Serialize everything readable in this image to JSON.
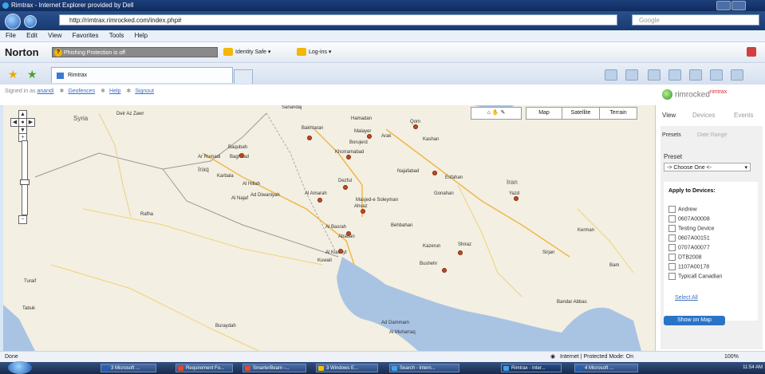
{
  "window": {
    "title": "Rimtrax - Internet Explorer provided by Dell"
  },
  "address": {
    "url": "http://rimtrax.rimrocked.com/index.php#",
    "search_placeholder": "Google"
  },
  "menu": {
    "items": [
      "File",
      "Edit",
      "View",
      "Favorites",
      "Tools",
      "Help"
    ]
  },
  "norton": {
    "logo": "Norton",
    "phishing": "Phishing Protection is off",
    "identity": "Identity Safe ▾",
    "login": "Log-ins ▾"
  },
  "tab": {
    "label": "Rimtrax"
  },
  "app": {
    "signed_prefix": "Signed in as",
    "user": "anandi",
    "links": [
      "Geofences",
      "Help",
      "Signout"
    ],
    "logo_text": "rimrocked",
    "logo_sup": "rimtrax"
  },
  "map": {
    "types": [
      "Map",
      "Satellite",
      "Terrain"
    ],
    "countries": [
      "Syria",
      "Iraq",
      "Iran"
    ],
    "cities": [
      "Deir Az Zawr",
      "Sanandaj",
      "Hamadan",
      "Qom",
      "Bakhtaran",
      "Malayer",
      "Arak",
      "Kashan",
      "Borujerd",
      "Khorramabad",
      "Baqubah",
      "Baghdad",
      "Ar Rumadi",
      "Karbala",
      "Dezful",
      "Najafabad",
      "Esfahan",
      "Al Hillah",
      "Ad Diwaniyah",
      "Al Najaf",
      "Al Amarah",
      "Masjed-e Soleyman",
      "Gonahan",
      "Yazd",
      "Ahvaz",
      "Rafha",
      "Al Basrah",
      "Behbahan",
      "Abadan",
      "Kerman",
      "Kazerun",
      "Shiraz",
      "Al Kuwayt",
      "Kuwait",
      "Bushehr",
      "Sirjan",
      "Bam",
      "Turaif",
      "Tabuk",
      "Bandar Abbas",
      "Ad Dammam",
      "Al Muharraq",
      "Buraydah"
    ]
  },
  "sidebar": {
    "tabs": [
      "View",
      "Devices",
      "Events"
    ],
    "subtabs": [
      "Presets",
      "Date Range"
    ],
    "preset_label": "Preset",
    "preset_value": "-> Choose One <-",
    "apply_label": "Apply to Devices:",
    "devices": [
      "Andrew",
      "0607A00008",
      "Testing Device",
      "0607A00151",
      "0707A00077",
      "DTB2008",
      "1107A00178",
      "Typicall Canadian"
    ],
    "select_all": "Select All",
    "show_on_map": "Show on Map"
  },
  "status": {
    "left": "Done",
    "zone": "Internet | Protected Mode: On",
    "zoom": "100%"
  },
  "taskbar": {
    "buttons": [
      "3 Microsoft ...",
      "Requirement Fo...",
      "SmarterBeam -...",
      "3 Windows E...",
      "Search - Intern...",
      "Rimtrax - Inter...",
      "4 Microsoft ..."
    ],
    "clock": "11:54 AM"
  },
  "colors": {
    "accent": "#2a74c8",
    "water": "#a9c4e3",
    "land": "#f3efe2"
  }
}
